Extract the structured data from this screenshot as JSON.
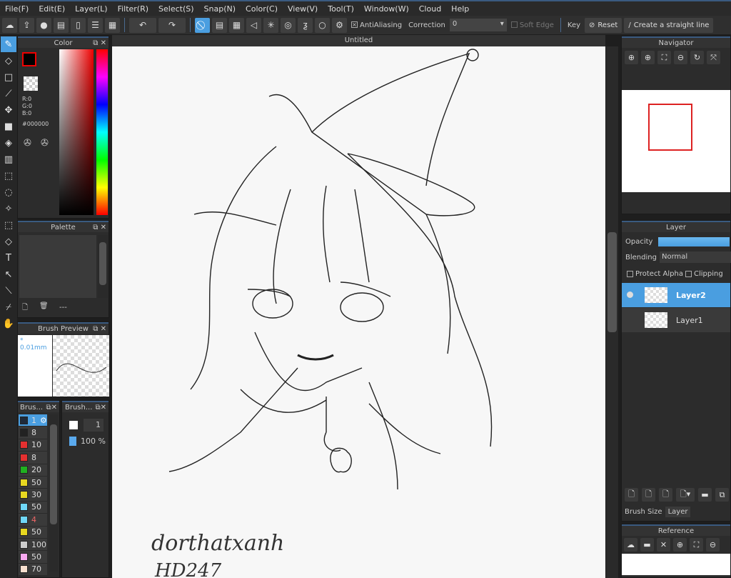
{
  "menu": [
    "File(F)",
    "Edit(E)",
    "Layer(L)",
    "Filter(R)",
    "Select(S)",
    "Snap(N)",
    "Color(C)",
    "View(V)",
    "Tool(T)",
    "Window(W)",
    "Cloud",
    "Help"
  ],
  "toolbar": {
    "antialiasing": "AntiAliasing",
    "correction_label": "Correction",
    "correction_value": "0",
    "soft_edge": "Soft Edge",
    "key": "Key",
    "reset": "Reset",
    "straight_line": "Create a straight line"
  },
  "color_panel": {
    "title": "Color",
    "r": "R:0",
    "g": "G:0",
    "b": "B:0",
    "hex": "#000000",
    "fg": "#000000"
  },
  "palette": {
    "title": "Palette",
    "empty": "---"
  },
  "brush_preview": {
    "title": "Brush Preview",
    "size": "* 0.01mm"
  },
  "brush_list": {
    "title": "Brus...",
    "items": [
      {
        "color": "#1e2a3a",
        "size": "1"
      },
      {
        "color": "#222222",
        "size": "8"
      },
      {
        "color": "#e53030",
        "size": "10"
      },
      {
        "color": "#e53030",
        "size": "8"
      },
      {
        "color": "#20b020",
        "size": "20"
      },
      {
        "color": "#e8d820",
        "size": "50"
      },
      {
        "color": "#e8d820",
        "size": "30"
      },
      {
        "color": "#70d8f8",
        "size": "50"
      },
      {
        "color": "#70d8f8",
        "size": "4"
      },
      {
        "color": "#e8d820",
        "size": "50"
      },
      {
        "color": "#cccccc",
        "size": "100"
      },
      {
        "color": "#f8a8f0",
        "size": "50"
      },
      {
        "color": "#f8e0d0",
        "size": "70"
      }
    ]
  },
  "brush_size": {
    "title": "Brush...",
    "size": "1",
    "opacity": "100 %"
  },
  "document": {
    "tab": "Untitled",
    "signature": "dorthatxanh",
    "signature2": "HD247"
  },
  "navigator": {
    "title": "Navigator"
  },
  "layer_panel": {
    "title": "Layer",
    "opacity_label": "Opacity",
    "opacity": 100,
    "blending_label": "Blending",
    "blending": "Normal",
    "protect_alpha": "Protect Alpha",
    "clipping": "Clipping",
    "layers": [
      {
        "name": "Layer2",
        "selected": true
      },
      {
        "name": "Layer1",
        "selected": false
      }
    ]
  },
  "bottom_tabs": [
    "Brush Size",
    "Layer"
  ],
  "reference": {
    "title": "Reference"
  },
  "accent": "#4a9ee0"
}
